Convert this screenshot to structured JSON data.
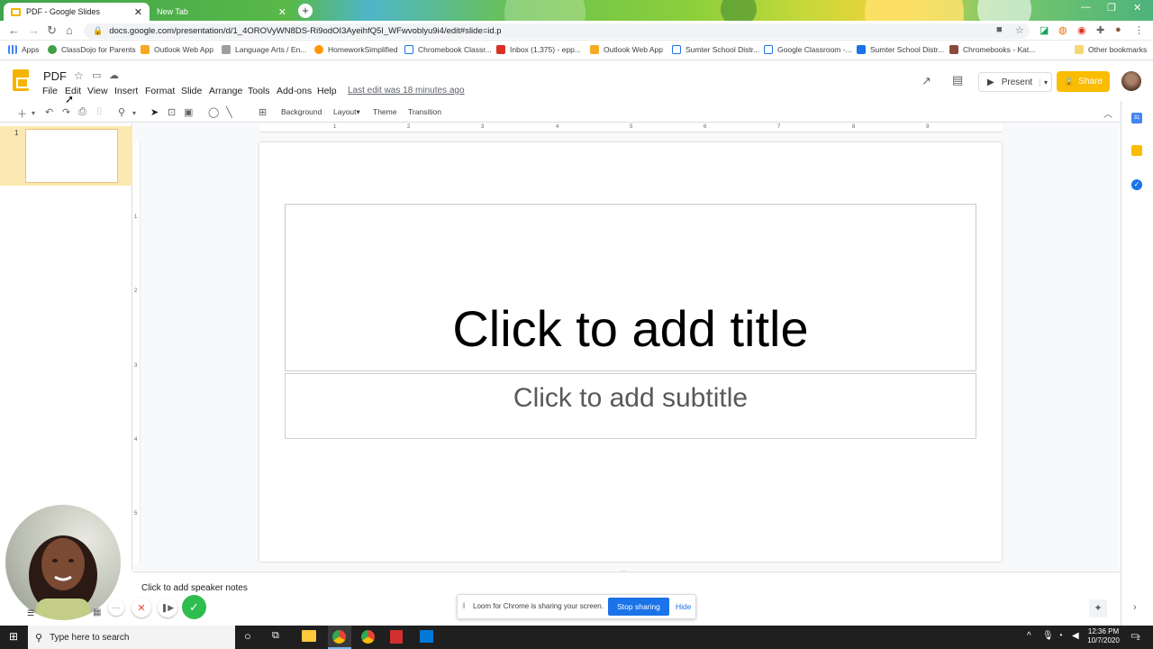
{
  "browser": {
    "tabs": [
      {
        "title": "PDF - Google Slides",
        "close": "✕"
      },
      {
        "title": "New Tab",
        "close": "✕"
      }
    ],
    "new_tab": "+",
    "url": "docs.google.com/presentation/d/1_4OROVyWN8DS-Ri9odOI3AyeihfQ5I_WFwvoblyu9i4/edit#slide=id.p",
    "bookmarks": [
      "Apps",
      "ClassDojo for Parents",
      "Outlook Web App",
      "Language Arts / En...",
      "HomeworkSimplified",
      "Chromebook Classr...",
      "Inbox (1,375) - epp...",
      "Outlook Web App",
      "Sumter School Distr...",
      "Google Classroom -...",
      "Sumter School Distr...",
      "Chromebooks - Kat...",
      "Other bookmarks"
    ]
  },
  "docs": {
    "title": "PDF",
    "menu": [
      "File",
      "Edit",
      "View",
      "Insert",
      "Format",
      "Slide",
      "Arrange",
      "Tools",
      "Add-ons",
      "Help"
    ],
    "last_edit": "Last edit was 18 minutes ago",
    "present_label": "Present",
    "share_label": "Share",
    "toolbar": {
      "background": "Background",
      "layout": "Layout▾",
      "theme": "Theme",
      "transition": "Transition"
    },
    "ruler_h": [
      "1",
      "2",
      "3",
      "4",
      "5",
      "6",
      "7",
      "8",
      "9"
    ],
    "ruler_v": [
      "1",
      "2",
      "3",
      "4",
      "5"
    ],
    "slide_number": "1",
    "slide": {
      "title_placeholder": "Click to add title",
      "subtitle_placeholder": "Click to add subtitle"
    },
    "speaker_notes": "Click to add speaker notes"
  },
  "loom": {
    "message": "Loom for Chrome is sharing your screen.",
    "stop_label": "Stop sharing",
    "hide_label": "Hide"
  },
  "taskbar": {
    "search_placeholder": "Type here to search",
    "time": "12:36 PM",
    "date": "10/7/2020",
    "notifications": "2"
  },
  "colors": {
    "slides_yellow": "#f4b400",
    "share_yellow": "#fbbc04",
    "loom_blue": "#1a73e8"
  }
}
